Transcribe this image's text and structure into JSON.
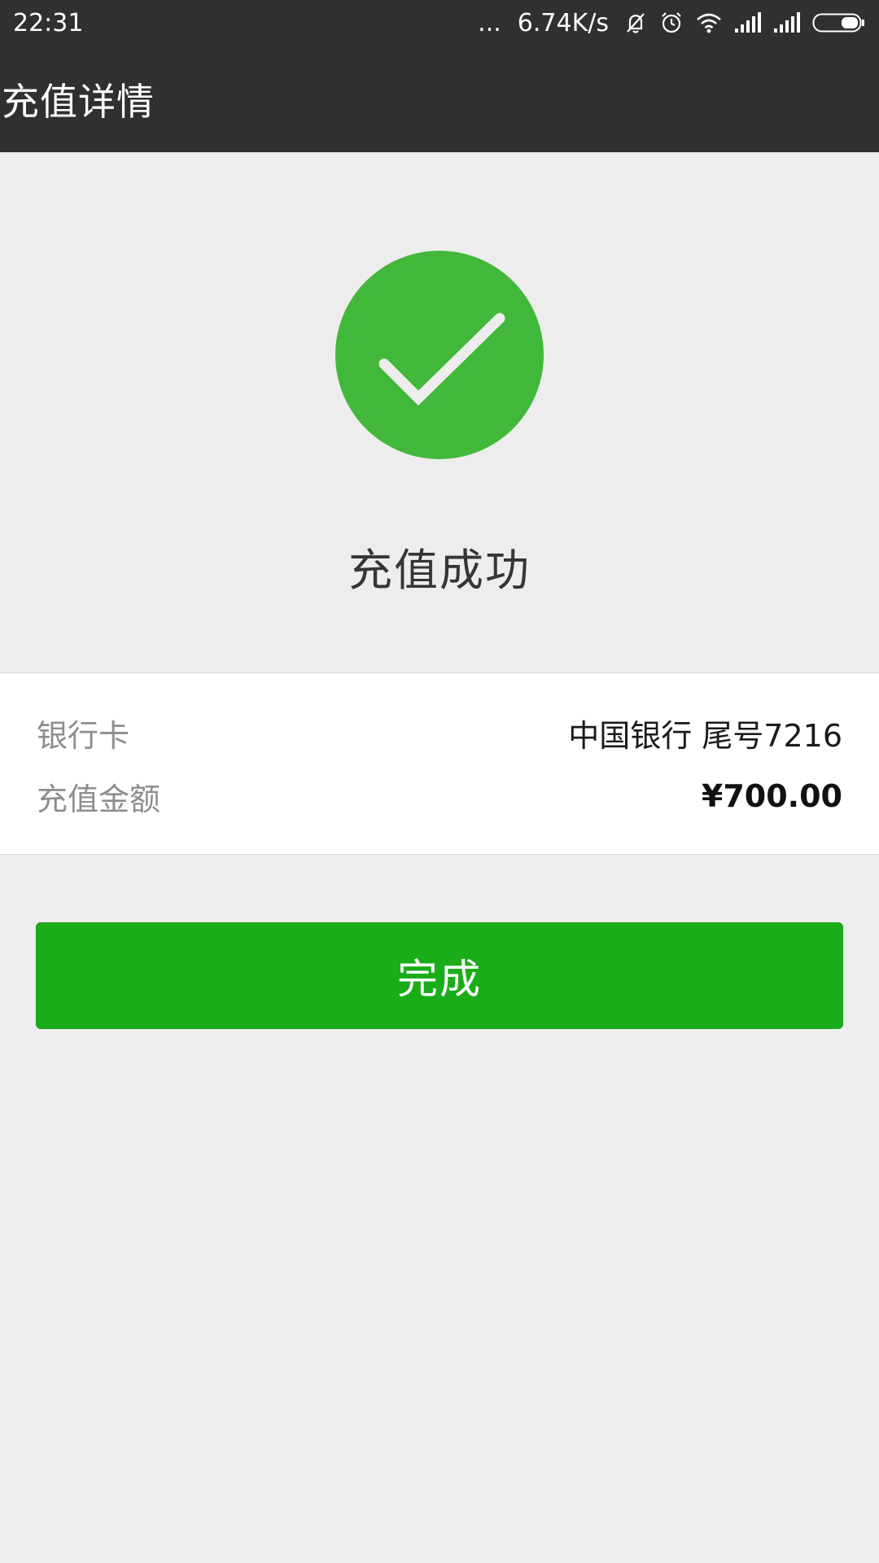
{
  "status_bar": {
    "time": "22:31",
    "more_indicator": "...",
    "network_speed": "6.74K/s",
    "icons": [
      "mute-bell-icon",
      "alarm-clock-icon",
      "wifi-icon",
      "signal-icon",
      "signal-icon",
      "battery-icon"
    ]
  },
  "header": {
    "title": "充值详情"
  },
  "result": {
    "icon": "checkmark-circle-icon",
    "message": "充值成功",
    "accent_color": "#42b83a"
  },
  "details": {
    "bank_card_label": "银行卡",
    "bank_card_value": "中国银行 尾号7216",
    "amount_label": "充值金额",
    "amount_value": "¥700.00"
  },
  "actions": {
    "done_label": "完成",
    "button_color": "#1aad19"
  }
}
